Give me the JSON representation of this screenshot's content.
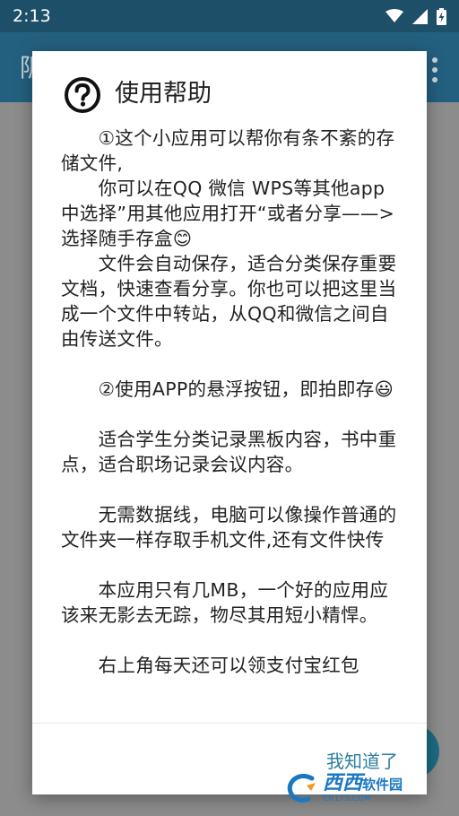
{
  "status_bar": {
    "time": "2:13"
  },
  "app": {
    "title_peek": "阪"
  },
  "dialog": {
    "title": "使用帮助",
    "paragraphs": [
      "　　①这个小应用可以帮你有条不紊的存储文件,",
      "　　你可以在QQ 微信 WPS等其他app中选择”用其他应用打开“或者分享——>选择随手存盒😊",
      "　　文件会自动保存，适合分类保存重要文档，快速查看分享。你也可以把这里当成一个文件中转站，从QQ和微信之间自由传送文件。",
      "",
      "　　②使用APP的悬浮按钮，即拍即存😃",
      "",
      "　　适合学生分类记录黑板内容，书中重点，适合职场记录会议内容。",
      "",
      "　　无需数据线，电脑可以像操作普通的文件夹一样存取手机文件,还有文件快传",
      "",
      "　　本应用只有几MB，一个好的应用应该来无影去无踪，物尽其用短小精悍。",
      "",
      "　　右上角每天还可以领支付宝红包"
    ],
    "ok_label": "我知道了"
  },
  "watermark": {
    "brand": "西西",
    "name": "软件园",
    "url": "CR173.COM"
  },
  "colors": {
    "status_bar": "#1d4f68",
    "app_bar": "#23607f",
    "accent": "#2b7fa0"
  }
}
